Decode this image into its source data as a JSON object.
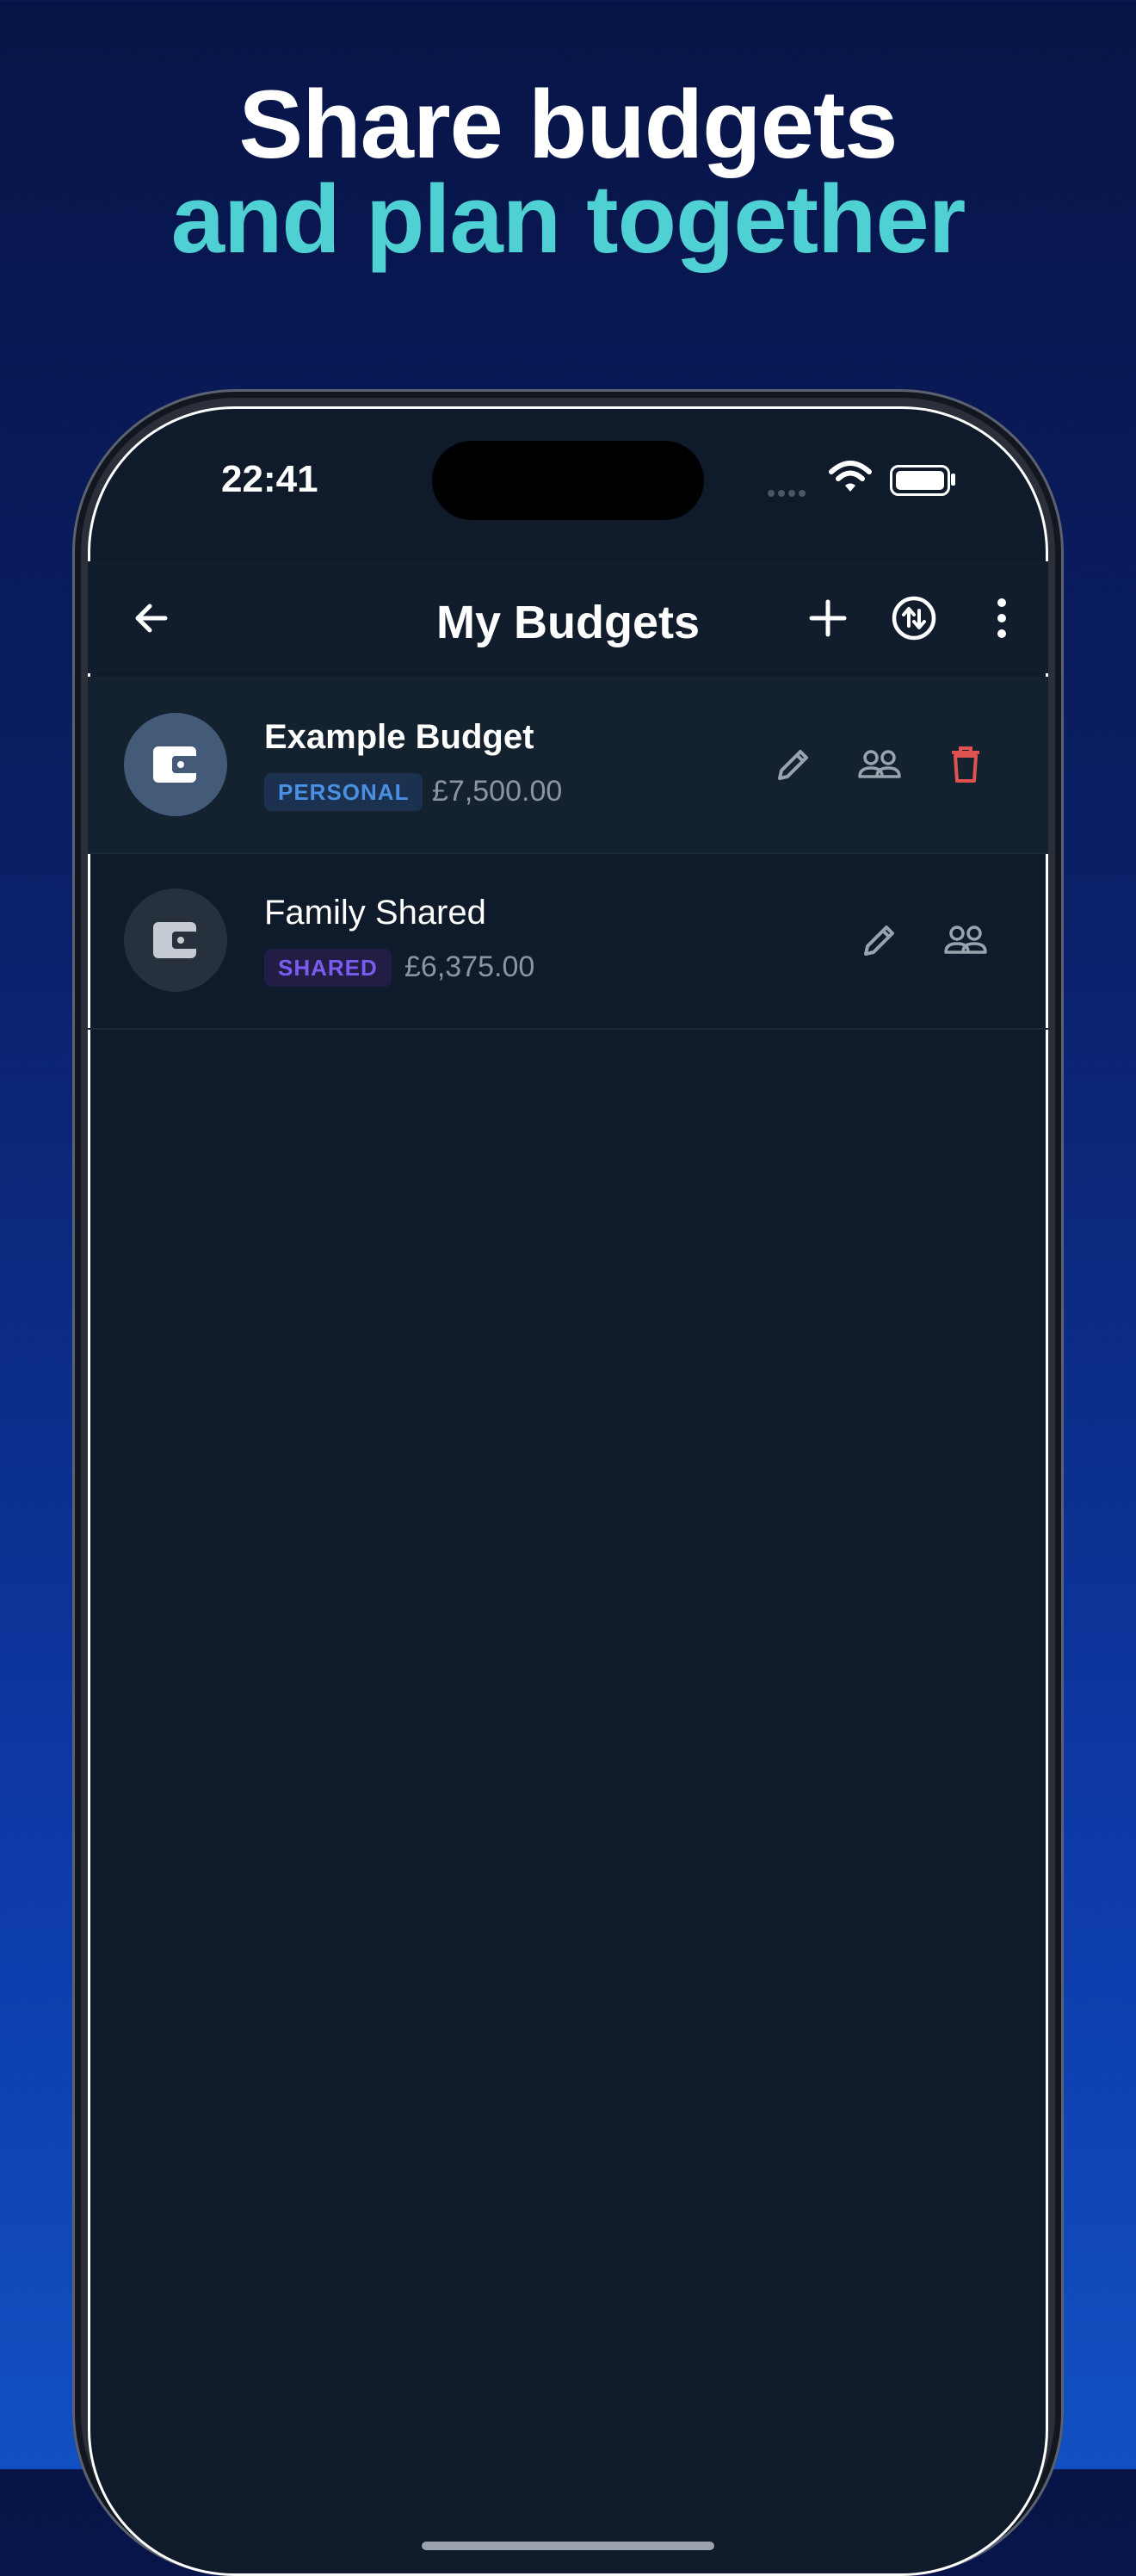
{
  "headline": {
    "line1": "Share budgets",
    "line2": "and plan together",
    "line1_color": "#ffffff",
    "line2_color": "#4fd1d3"
  },
  "status_bar": {
    "time": "22:41"
  },
  "app_bar": {
    "title": "My Budgets",
    "icons": [
      "back-arrow-icon",
      "add-icon",
      "swap-icon",
      "more-vert-icon"
    ]
  },
  "budgets": [
    {
      "name": "Example Budget",
      "type": "PERSONAL",
      "amount": "£7,500.00",
      "selected": true,
      "actions": [
        "edit-icon",
        "people-icon",
        "delete-icon"
      ]
    },
    {
      "name": "Family Shared",
      "type": "SHARED",
      "amount": "£6,375.00",
      "selected": false,
      "actions": [
        "edit-icon",
        "people-icon"
      ]
    }
  ],
  "colors": {
    "personal_badge_text": "#4a90e2",
    "personal_badge_bg": "#1c3050",
    "shared_badge_text": "#7c5cf0",
    "shared_badge_bg": "#221d45",
    "delete": "#e05252",
    "screen_bg": "#0f1a2a"
  }
}
